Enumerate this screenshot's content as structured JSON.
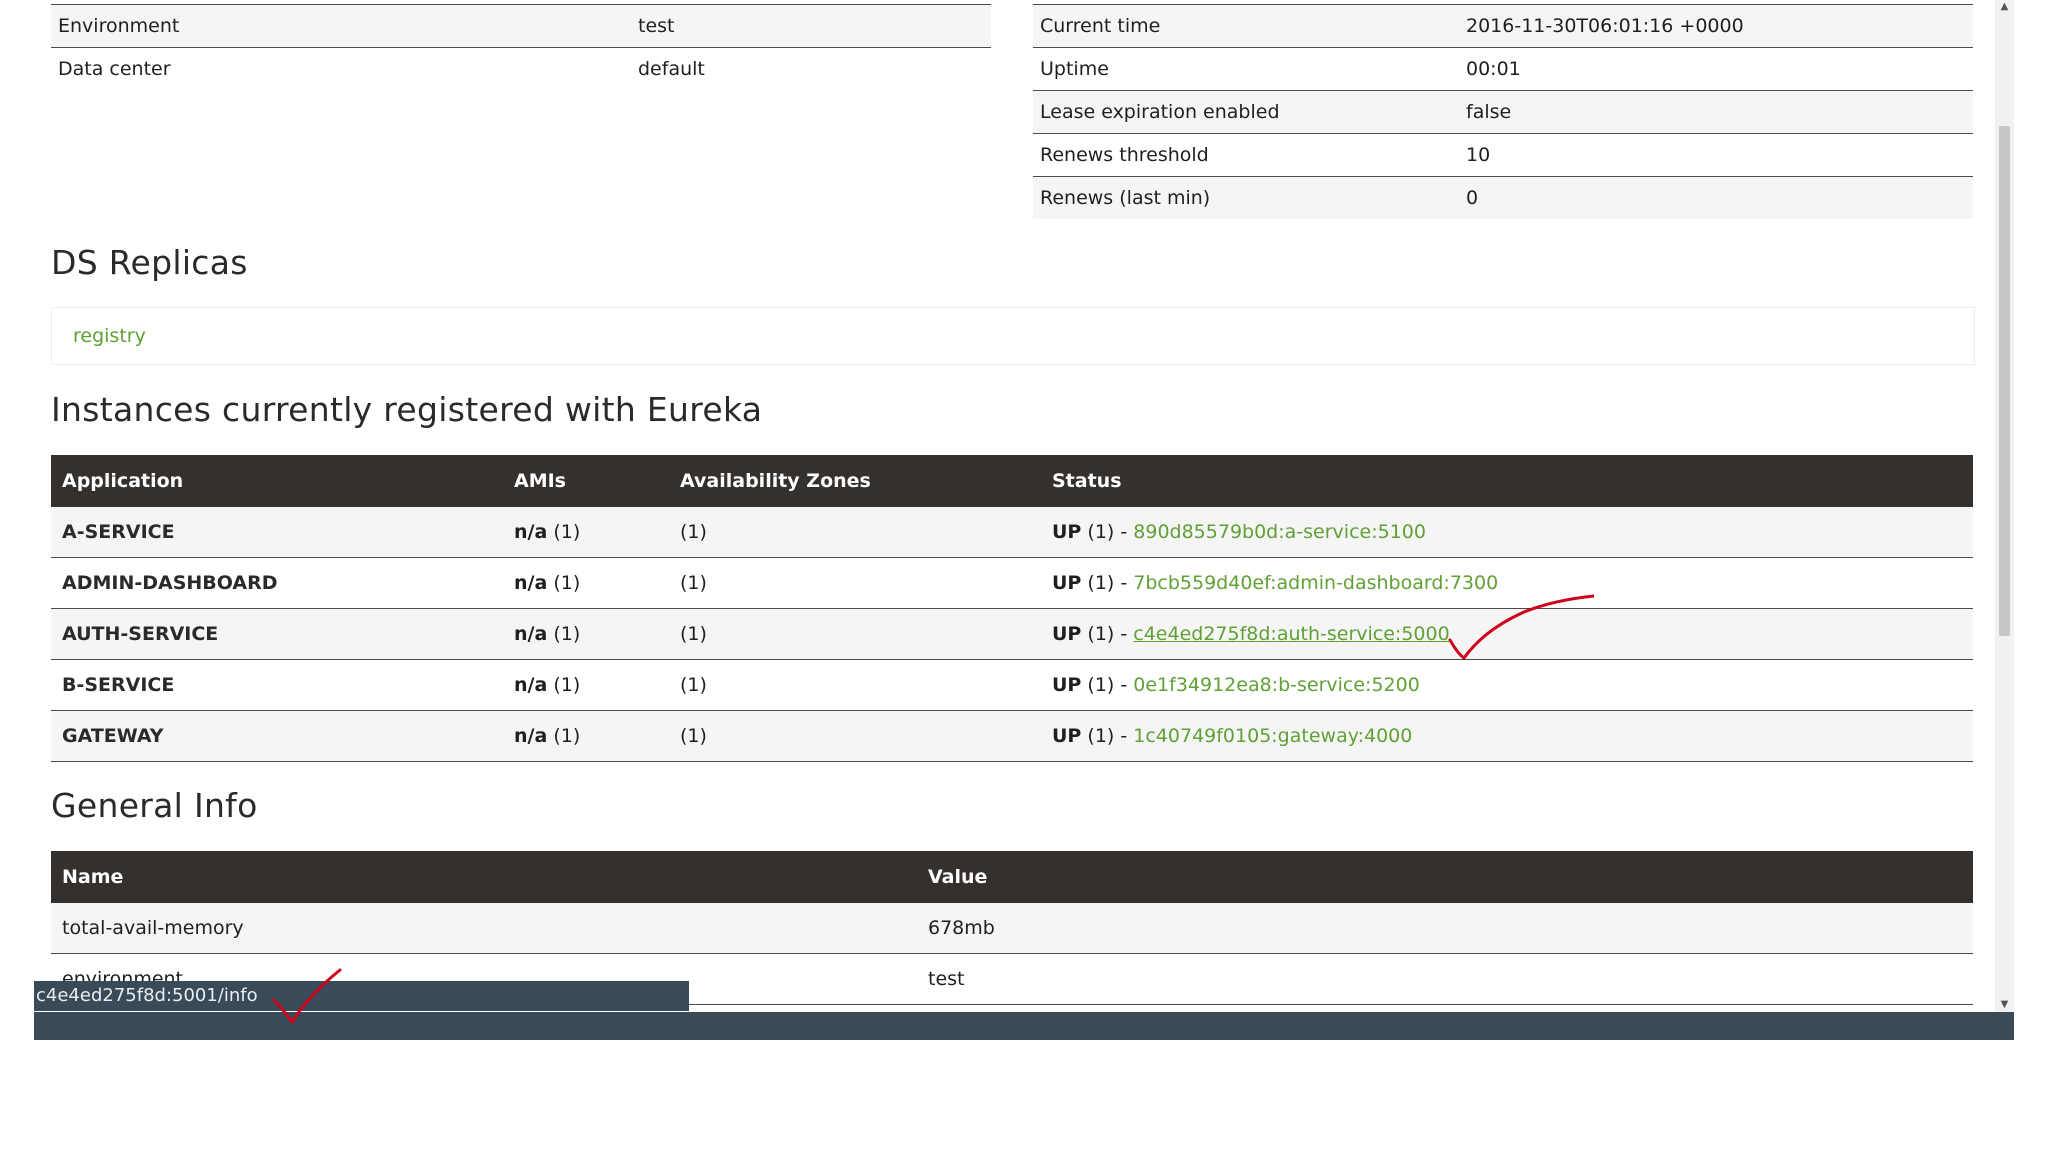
{
  "system_status_left": [
    {
      "key": "Environment",
      "value": "test"
    },
    {
      "key": "Data center",
      "value": "default"
    }
  ],
  "system_status_right": [
    {
      "key": "Current time",
      "value": "2016-11-30T06:01:16 +0000"
    },
    {
      "key": "Uptime",
      "value": "00:01"
    },
    {
      "key": "Lease expiration enabled",
      "value": "false"
    },
    {
      "key": "Renews threshold",
      "value": "10"
    },
    {
      "key": "Renews (last min)",
      "value": "0"
    }
  ],
  "ds_replicas": {
    "title": "DS Replicas",
    "link": "registry"
  },
  "instances": {
    "title": "Instances currently registered with Eureka",
    "headers": [
      "Application",
      "AMIs",
      "Availability Zones",
      "Status"
    ],
    "rows": [
      {
        "application": "A-SERVICE",
        "amis_bold": "n/a",
        "amis_count": "(1)",
        "zones": "(1)",
        "status_bold": "UP",
        "status_count": "(1) -",
        "instance": "890d85579b0d:a-service:5100"
      },
      {
        "application": "ADMIN-DASHBOARD",
        "amis_bold": "n/a",
        "amis_count": "(1)",
        "zones": "(1)",
        "status_bold": "UP",
        "status_count": "(1) -",
        "instance": "7bcb559d40ef:admin-dashboard:7300"
      },
      {
        "application": "AUTH-SERVICE",
        "amis_bold": "n/a",
        "amis_count": "(1)",
        "zones": "(1)",
        "status_bold": "UP",
        "status_count": "(1) -",
        "instance": "c4e4ed275f8d:auth-service:5000"
      },
      {
        "application": "B-SERVICE",
        "amis_bold": "n/a",
        "amis_count": "(1)",
        "zones": "(1)",
        "status_bold": "UP",
        "status_count": "(1) -",
        "instance": "0e1f34912ea8:b-service:5200"
      },
      {
        "application": "GATEWAY",
        "amis_bold": "n/a",
        "amis_count": "(1)",
        "zones": "(1)",
        "status_bold": "UP",
        "status_count": "(1) -",
        "instance": "1c40749f0105:gateway:4000"
      }
    ]
  },
  "general_info": {
    "title": "General Info",
    "headers": [
      "Name",
      "Value"
    ],
    "rows": [
      {
        "name": "total-avail-memory",
        "value": "678mb"
      },
      {
        "name": "environment",
        "value": "test"
      }
    ]
  },
  "status_tooltip": "c4e4ed275f8d:5001/info",
  "colors": {
    "link": "#5fa134",
    "table_header": "#34302d",
    "bottom_bar": "#394b58",
    "annotation": "#d0021b"
  }
}
